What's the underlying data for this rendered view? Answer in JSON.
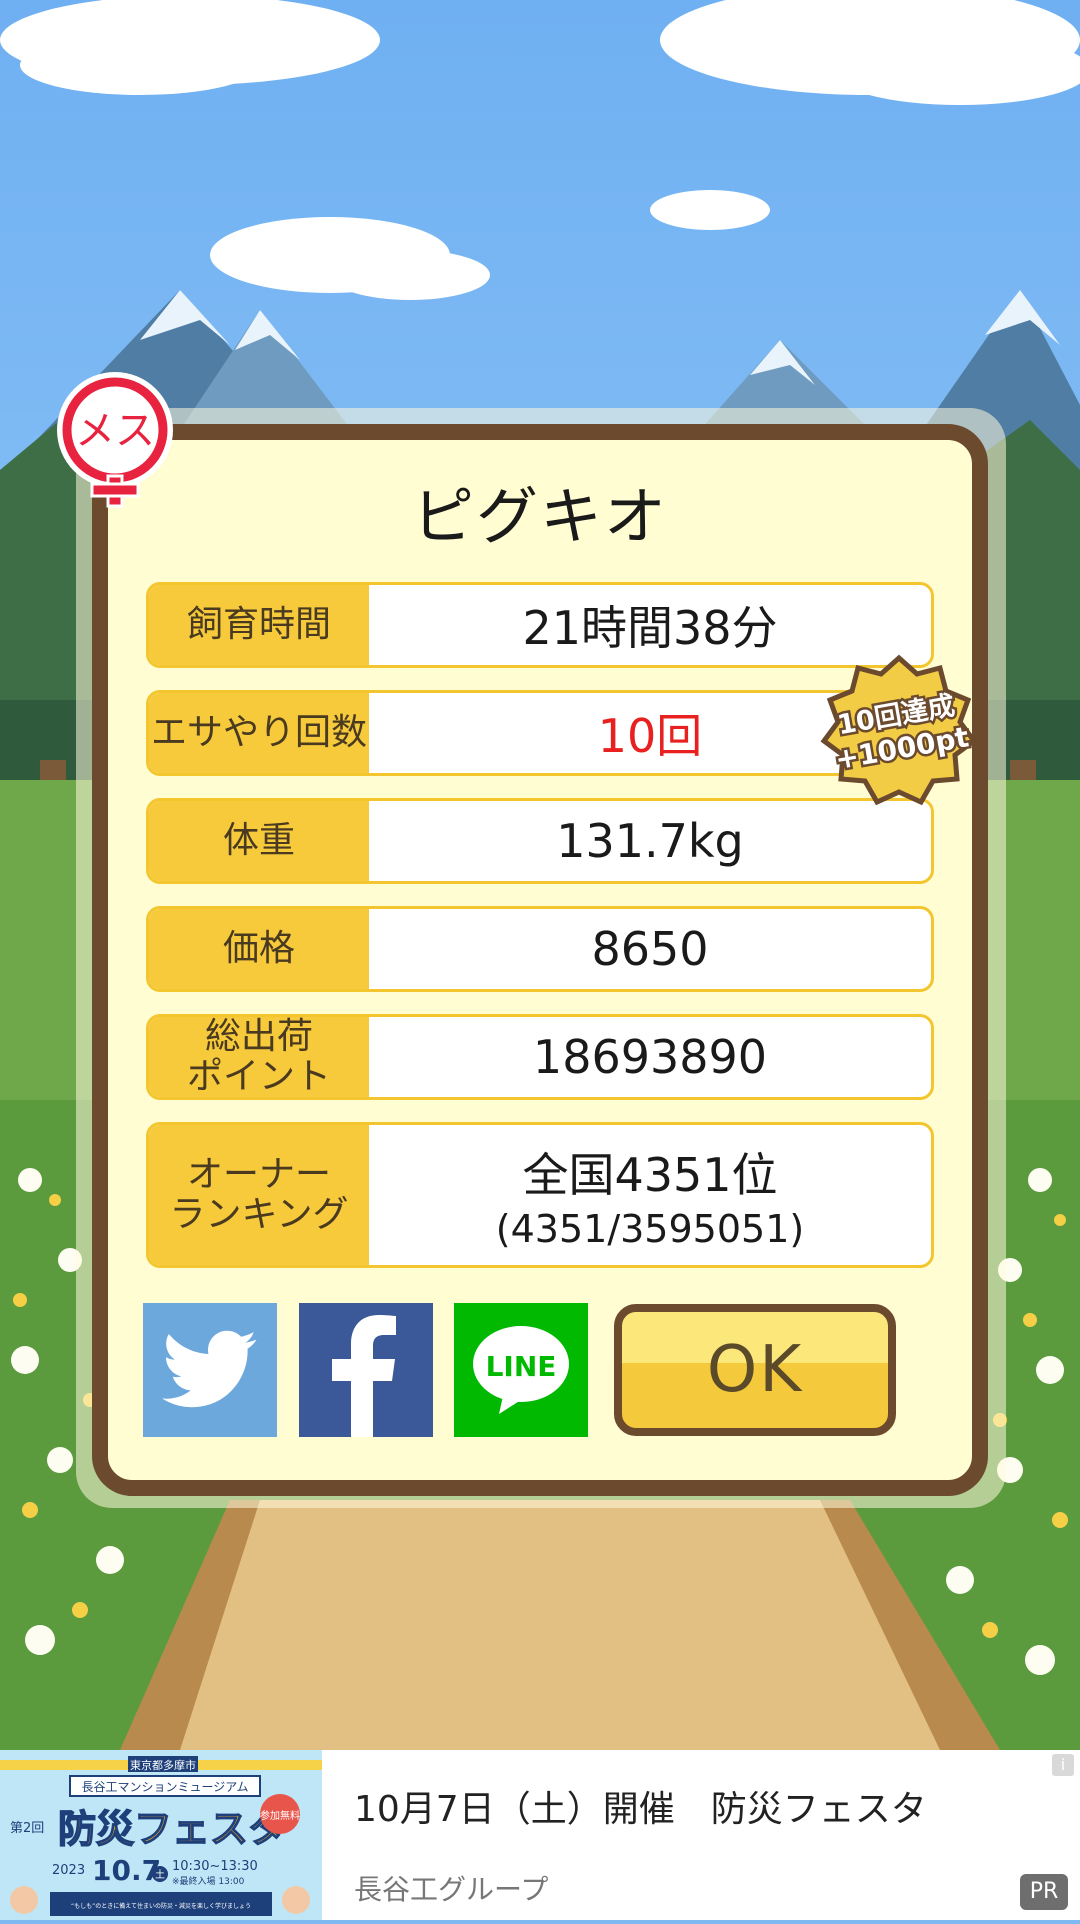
{
  "pig": {
    "name": "ピグキオ",
    "gender_label": "メス"
  },
  "stats": [
    {
      "label": "飼育時間",
      "value": "21時間38分"
    },
    {
      "label": "エサやり回数",
      "value": "10回"
    },
    {
      "label": "体重",
      "value": "131.7kg"
    },
    {
      "label": "価格",
      "value": "8650"
    },
    {
      "label": "総出荷\nポイント",
      "value": "18693890"
    },
    {
      "label": "オーナー\nランキング",
      "value": "全国4351位",
      "sub": "(4351/3595051)"
    }
  ],
  "achievement": {
    "line1": "10回達成",
    "line2": "+1000pt"
  },
  "buttons": {
    "twitter": "twitter-icon",
    "facebook": "facebook-icon",
    "line": "LINE",
    "ok": "OK"
  },
  "ad": {
    "title": "10月7日（土）開催　防災フェスタ",
    "advertiser": "長谷工グループ",
    "pr_label": "PR",
    "info_label": "i",
    "image": {
      "city": "東京都多摩市",
      "museum": "長谷工マンションミュージアム",
      "edition": "第2回",
      "event": "防災フェスタ",
      "free_badge": "参加無料",
      "year": "2023",
      "date": "10.7",
      "weekday": "土",
      "time": "10:30~13:30",
      "note": "※最終入場 13:00",
      "tagline": "“もしも”のときに備えて住まいの防災・減災を楽しく学びましょう"
    }
  },
  "colors": {
    "label_bg": "#f7ca3c",
    "panel_border": "#6b4a2e",
    "panel_bg": "#fffdd1",
    "highlight_text": "#e8201f",
    "twitter": "#6da8dd",
    "facebook": "#3b5998",
    "line": "#00b900"
  }
}
